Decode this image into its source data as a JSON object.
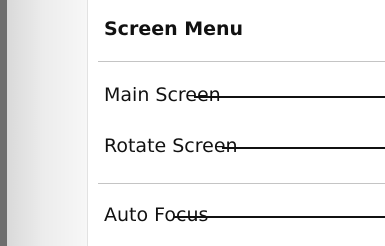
{
  "menu": {
    "title": "Screen Menu",
    "items": [
      {
        "label": "Main Screen"
      },
      {
        "label": "Rotate Screen"
      },
      {
        "label": "Auto Focus"
      }
    ]
  },
  "colors": {
    "border": "#6e6e6e",
    "gutter": "#ececec",
    "text": "#111111",
    "divider": "#c4c4c4"
  }
}
